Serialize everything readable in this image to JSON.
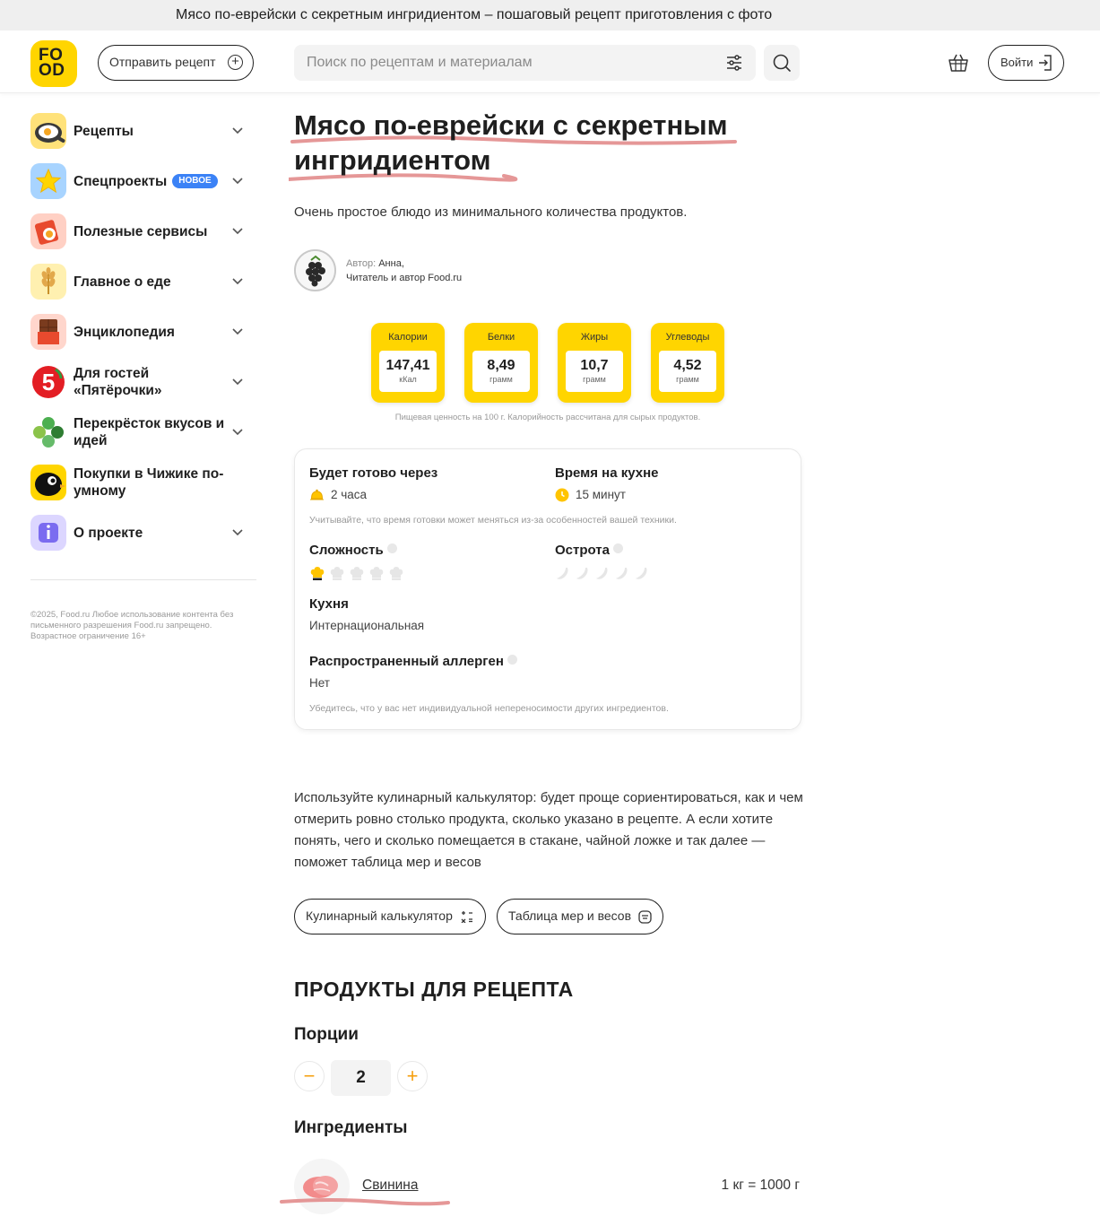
{
  "browser": {
    "title": "Мясо по-еврейски с секретным ингридиентом – пошаговый рецепт приготовления с фото"
  },
  "header": {
    "logo": "FOOD",
    "send_recipe": "Отправить рецепт",
    "search_placeholder": "Поиск по рецептам и материалам",
    "login": "Войти"
  },
  "sidebar": {
    "items": [
      {
        "label": "Рецепты",
        "icon": "frying-pan-icon"
      },
      {
        "label": "Спецпроекты",
        "badge": "НОВОЕ",
        "icon": "star-icon"
      },
      {
        "label": "Полезные сервисы",
        "icon": "services-icon"
      },
      {
        "label": "Главное о еде",
        "icon": "wheat-icon"
      },
      {
        "label": "Энциклопедия",
        "icon": "chocolate-icon"
      },
      {
        "label": "Для гостей «Пятёрочки»",
        "icon": "pyaterochka-icon"
      },
      {
        "label": "Перекрёсток вкусов и идей",
        "icon": "clover-icon"
      },
      {
        "label": "Покупки в Чижике по-умному",
        "icon": "bird-icon"
      },
      {
        "label": "О проекте",
        "icon": "info-icon"
      }
    ],
    "copyright": "©2025, Food.ru Любое использование контента без письменного разрешения Food.ru запрещено. Возрастное ограничение 16+"
  },
  "recipe": {
    "title": "Мясо по-еврейски с секретным ингридиентом",
    "description": "Очень простое блюдо из минимального количества продуктов.",
    "author_label": "Автор:",
    "author_name": "Анна,",
    "author_role": "Читатель и автор Food.ru",
    "nutrition": [
      {
        "label": "Калории",
        "value": "147,41",
        "unit": "кКал"
      },
      {
        "label": "Белки",
        "value": "8,49",
        "unit": "грамм"
      },
      {
        "label": "Жиры",
        "value": "10,7",
        "unit": "грамм"
      },
      {
        "label": "Углеводы",
        "value": "4,52",
        "unit": "грамм"
      }
    ],
    "nutrition_note": "Пищевая ценность на 100 г. Калорийность рассчитана для сырых продуктов.",
    "info": {
      "ready_label": "Будет готово через",
      "ready_value": "2 часа",
      "kitchen_label": "Время на кухне",
      "kitchen_value": "15 минут",
      "time_note": "Учитывайте, что время готовки может меняться из-за особенностей вашей техники.",
      "difficulty_label": "Сложность",
      "difficulty_level": 1,
      "difficulty_max": 5,
      "spiciness_label": "Острота",
      "spiciness_level": 0,
      "spiciness_max": 5,
      "cuisine_label": "Кухня",
      "cuisine_value": "Интернациональная",
      "allergen_label": "Распространенный аллерген",
      "allergen_value": "Нет",
      "allergen_note": "Убедитесь, что у вас нет индивидуальной непереносимости других ингредиентов."
    },
    "calc_text": "Используйте кулинарный калькулятор: будет проще сориентироваться, как и чем отмерить ровно столько продукта, сколько указано в рецепте. А если хотите понять, чего и сколько помещается в стакане, чайной ложке и так далее — поможет таблица мер и весов",
    "calc_button": "Кулинарный калькулятор",
    "measures_button": "Таблица мер и весов",
    "products_heading": "ПРОДУКТЫ ДЛЯ РЕЦЕПТА",
    "portions_heading": "Порции",
    "portions_value": "2",
    "ingredients_heading": "Ингредиенты",
    "ingredients": [
      {
        "name": "Свинина",
        "qty": "1 кг = 1000 г"
      }
    ]
  },
  "colors": {
    "brand_yellow": "#ffd500",
    "accent_orange": "#f59e0b",
    "badge_blue": "#3b82f6",
    "annotation_red": "#e08585"
  }
}
